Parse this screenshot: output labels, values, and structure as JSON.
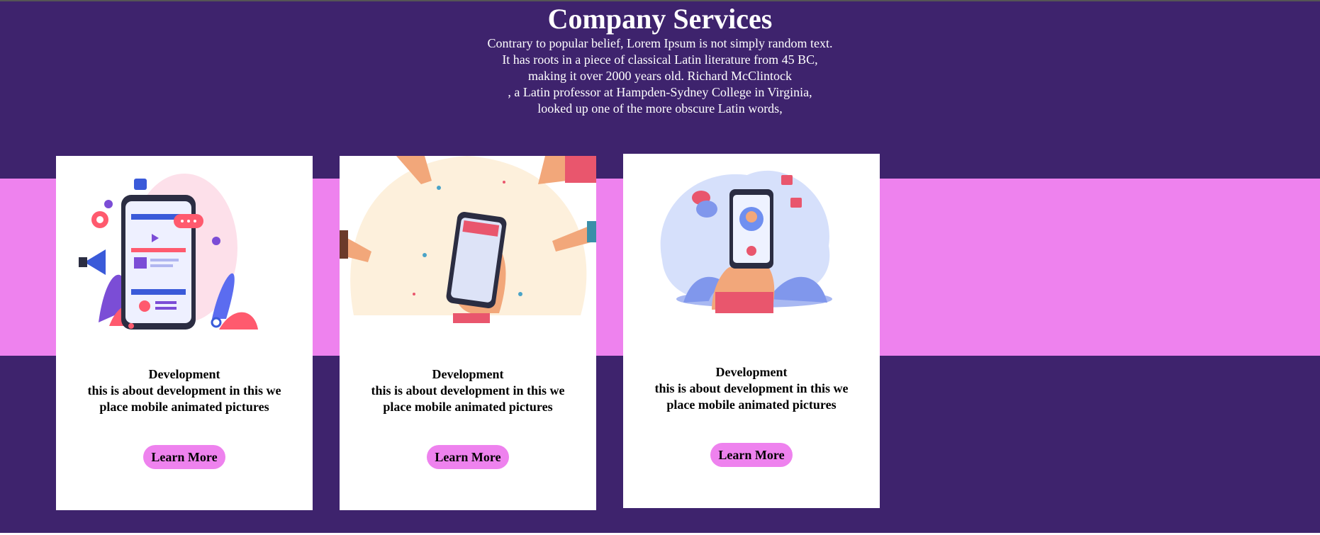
{
  "header": {
    "title": "Company Services",
    "intro_lines": [
      "Contrary to popular belief, Lorem Ipsum is not simply random text.",
      "It has roots in a piece of classical Latin literature from 45 BC,",
      "making it over 2000 years old. Richard McClintock",
      ", a Latin professor at Hampden-Sydney College in Virginia,",
      "looked up one of the more obscure Latin words,"
    ]
  },
  "colors": {
    "background": "#3e236d",
    "band": "#ee82ee",
    "card": "#ffffff",
    "button": "#ee82ee"
  },
  "cards": [
    {
      "title": "Development",
      "desc_line1": "this is about development in this we",
      "desc_line2": "place mobile animated pictures",
      "button": "Learn More",
      "image": "mobile-marketing-illustration"
    },
    {
      "title": "Development",
      "desc_line1": "this is about development in this we",
      "desc_line2": "place mobile animated pictures",
      "button": "Learn More",
      "image": "mobile-news-illustration"
    },
    {
      "title": "Development",
      "desc_line1": "this is about development in this we",
      "desc_line2": "place mobile animated pictures",
      "button": "Learn More",
      "image": "video-call-illustration"
    }
  ]
}
